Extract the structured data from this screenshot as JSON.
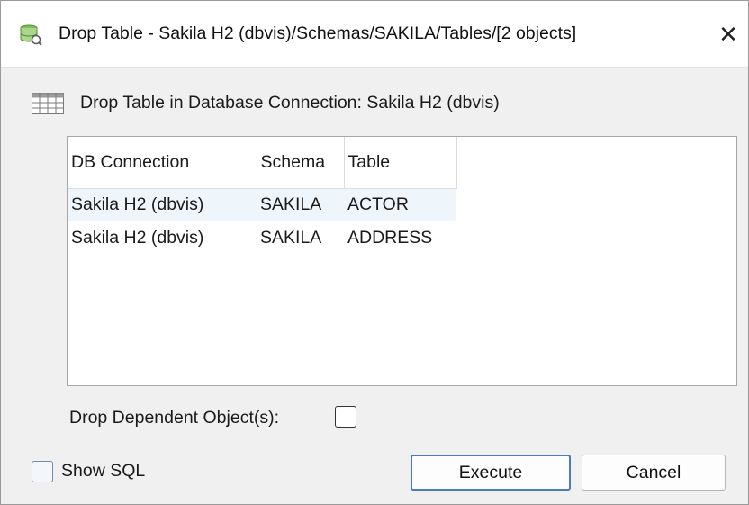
{
  "window": {
    "title": "Drop Table - Sakila H2 (dbvis)/Schemas/SAKILA/Tables/[2 objects]",
    "close_symbol": "✕",
    "icon": "database-icon"
  },
  "group": {
    "title": "Drop Table in Database Connection: Sakila H2 (dbvis)",
    "icon": "table-grid-icon"
  },
  "table": {
    "columns": [
      "DB Connection",
      "Schema",
      "Table"
    ],
    "rows": [
      [
        "Sakila H2 (dbvis)",
        "SAKILA",
        "ACTOR"
      ],
      [
        "Sakila H2 (dbvis)",
        "SAKILA",
        "ADDRESS"
      ]
    ]
  },
  "options": {
    "drop_dependent_label": "Drop Dependent Object(s):",
    "drop_dependent_checked": false,
    "show_sql_label": "Show SQL",
    "show_sql_checked": false
  },
  "buttons": {
    "execute": "Execute",
    "cancel": "Cancel"
  },
  "colors": {
    "accent": "#4a7bbf",
    "selection": "#eef5fb"
  }
}
